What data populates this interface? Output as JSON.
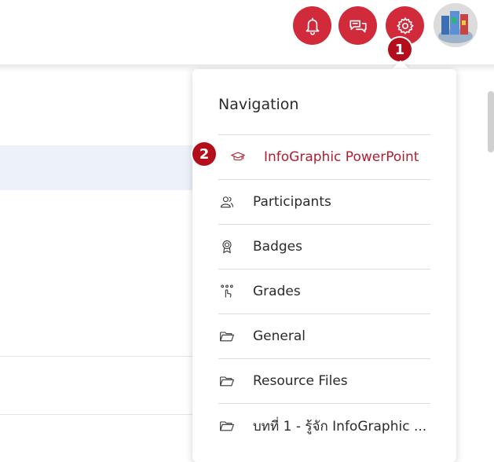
{
  "header": {
    "icons": [
      "bell-icon",
      "chat-icon",
      "gear-icon",
      "avatar"
    ],
    "accent_color": "#d12a3a"
  },
  "annotations": {
    "step1": "1",
    "step2": "2"
  },
  "navigation": {
    "title": "Navigation",
    "items": [
      {
        "label": "InfoGraphic PowerPoint",
        "icon": "graduation-cap-icon",
        "active": true
      },
      {
        "label": "Participants",
        "icon": "users-icon"
      },
      {
        "label": "Badges",
        "icon": "badge-icon"
      },
      {
        "label": "Grades",
        "icon": "grades-icon"
      },
      {
        "label": "General",
        "icon": "folder-icon"
      },
      {
        "label": "Resource Files",
        "icon": "folder-icon"
      },
      {
        "label": "บทที่ 1 - รู้จัก InfoGraphic ...",
        "icon": "folder-icon"
      }
    ]
  }
}
